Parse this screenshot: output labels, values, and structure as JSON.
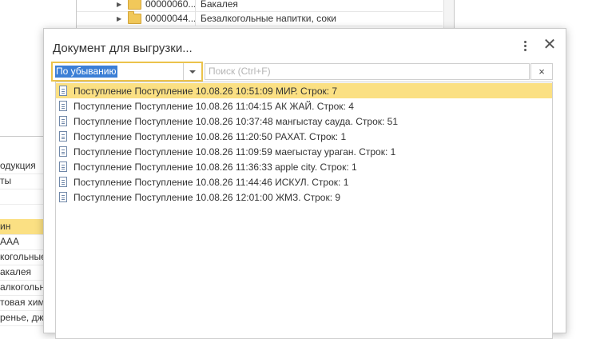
{
  "background": {
    "tree_rows": [
      {
        "code": "00000060...",
        "name": "Бакалея"
      },
      {
        "code": "00000044...",
        "name": "Безалкогольные напитки, соки"
      }
    ],
    "left_rows": [
      "одукция",
      "ты",
      "",
      "",
      "ин",
      "ААА",
      "когольные",
      "акалея",
      "алкогольн",
      "товая хими",
      "ренье, дже"
    ]
  },
  "dialog": {
    "title": "Документ для выгрузки...",
    "more_icon": "more-vertical-icon",
    "close_label": "✕",
    "sort_combo": {
      "value": "По убыванию"
    },
    "search": {
      "placeholder": "Поиск (Ctrl+F)",
      "value": "",
      "clear_label": "×"
    },
    "items": [
      "Поступление Поступление 10.08.26 10:51:09 МИР.  Строк: 7",
      "Поступление Поступление 10.08.26 11:04:15 АК ЖАЙ.  Строк: 4",
      "Поступление Поступление 10.08.26 10:37:48 мангыстау сауда.  Строк: 51",
      "Поступление Поступление 10.08.26 11:20:50 РАХАТ.  Строк: 1",
      "Поступление Поступление 10.08.26 11:09:59 маегыстау ураган. Строк: 1",
      "Поступление Поступление 10.08.26 11:36:33 apple city.  Строк: 1",
      "Поступление Поступление 10.08.26 11:44:46 ИСКУЛ.  Строк: 1",
      "Поступление Поступление 10.08.26 12:01:00 ЖМЗ.  Строк: 9"
    ],
    "selected_index": 0
  },
  "colors": {
    "selection": "#fbe083",
    "focus_border": "#ebc34b",
    "text_selection": "#3c7fd6"
  }
}
